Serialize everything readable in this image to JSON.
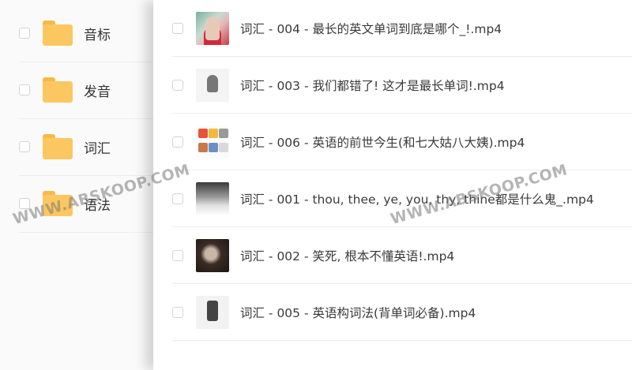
{
  "folders": [
    {
      "label": "音标"
    },
    {
      "label": "发音"
    },
    {
      "label": "词汇"
    },
    {
      "label": "语法"
    }
  ],
  "files": [
    {
      "name": "词汇 - 004 - 最长的英文单词到底是哪个_!.mp4"
    },
    {
      "name": "词汇 - 003 - 我们都错了! 这才是最长单词!.mp4"
    },
    {
      "name": "词汇 - 006 - 英语的前世今生(和七大姑八大姨).mp4"
    },
    {
      "name": "词汇 - 001 - thou, thee, ye, you, thy, thine都是什么鬼_.mp4"
    },
    {
      "name": "词汇 - 002 - 笑死, 根本不懂英语!.mp4"
    },
    {
      "name": "词汇 - 005 - 英语构词法(背单词必备).mp4"
    }
  ],
  "watermark": {
    "left": "WWW.ABSKOOP.COM",
    "right": "WWW.ABSKOOP.COM"
  },
  "colors": {
    "folder": "#fcc760",
    "folder_tab": "#f8b94a",
    "text": "#333333",
    "divider": "#ececec"
  },
  "icons": {
    "folder": "folder-icon",
    "checkbox": "checkbox-icon",
    "video_thumbnail": "video-thumbnail-icon"
  }
}
